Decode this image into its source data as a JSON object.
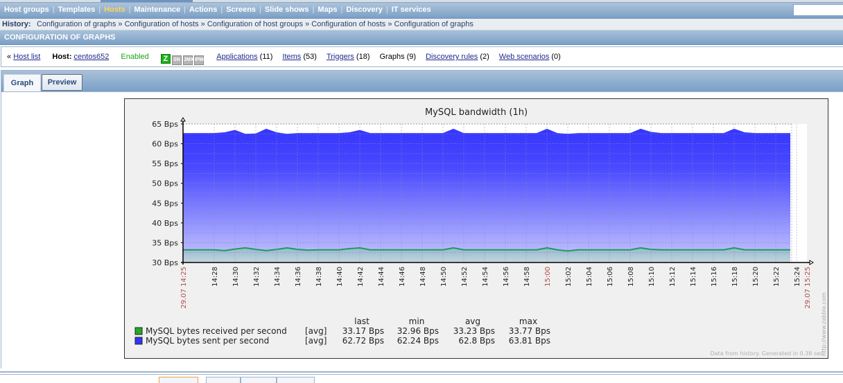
{
  "menu": {
    "items": [
      {
        "label": "Host groups",
        "active": false
      },
      {
        "label": "Templates",
        "active": false
      },
      {
        "label": "Hosts",
        "active": true
      },
      {
        "label": "Maintenance",
        "active": false
      },
      {
        "label": "Actions",
        "active": false
      },
      {
        "label": "Screens",
        "active": false
      },
      {
        "label": "Slide shows",
        "active": false
      },
      {
        "label": "Maps",
        "active": false
      },
      {
        "label": "Discovery",
        "active": false
      },
      {
        "label": "IT services",
        "active": false
      }
    ],
    "search_value": ""
  },
  "history": {
    "label": "History:",
    "crumbs": [
      "Configuration of graphs",
      "Configuration of hosts",
      "Configuration of host groups",
      "Configuration of hosts",
      "Configuration of graphs"
    ],
    "separator": "»"
  },
  "page_title": "CONFIGURATION OF GRAPHS",
  "hostbar": {
    "back_prefix": "«",
    "host_list": "Host list",
    "host_label": "Host:",
    "host_name": "centos652",
    "status": "Enabled",
    "availability": [
      {
        "name": "zabbix-agent",
        "glyph": "Z",
        "on": true
      },
      {
        "name": "snmp",
        "glyph": "SN",
        "on": false
      },
      {
        "name": "jmx",
        "glyph": "JMX",
        "on": false
      },
      {
        "name": "ipmi",
        "glyph": "IPMI",
        "on": false
      }
    ],
    "links": [
      {
        "label": "Applications",
        "count": "(11)",
        "link": true
      },
      {
        "label": "Items",
        "count": "(53)",
        "link": true
      },
      {
        "label": "Triggers",
        "count": "(18)",
        "link": true
      },
      {
        "label": "Graphs",
        "count": "(9)",
        "link": false
      },
      {
        "label": "Discovery rules",
        "count": "(2)",
        "link": true
      },
      {
        "label": "Web scenarios",
        "count": "(0)",
        "link": true
      }
    ]
  },
  "tabs": [
    {
      "label": "Graph",
      "active": true
    },
    {
      "label": "Preview",
      "active": false
    }
  ],
  "colors": {
    "received": "#1a9b5a",
    "received_legend": "#22aa22",
    "sent": "#3333ff",
    "axis_red": "#b24c4c"
  },
  "chart_data": {
    "type": "area",
    "title": "MySQL bandwidth (1h)",
    "xlabel": "",
    "ylabel": "",
    "y_unit": "Bps",
    "ylim": [
      30,
      65
    ],
    "yticks": [
      "30 Bps",
      "35 Bps",
      "40 Bps",
      "45 Bps",
      "50 Bps",
      "55 Bps",
      "60 Bps",
      "65 Bps"
    ],
    "ytick_values": [
      30,
      35,
      40,
      45,
      50,
      55,
      60,
      65
    ],
    "x_start_label": "29.07 14:25",
    "x_end_label": "29.07 15:25",
    "xticks": [
      "14:28",
      "14:30",
      "14:32",
      "14:34",
      "14:36",
      "14:38",
      "14:40",
      "14:42",
      "14:44",
      "14:46",
      "14:48",
      "14:50",
      "14:52",
      "14:54",
      "14:56",
      "14:58",
      "15:00",
      "15:02",
      "15:04",
      "15:06",
      "15:08",
      "15:10",
      "15:12",
      "15:14",
      "15:16",
      "15:18",
      "15:20",
      "15:22",
      "15:24"
    ],
    "xtick_minutes": [
      3,
      5,
      7,
      9,
      11,
      13,
      15,
      17,
      19,
      21,
      23,
      25,
      27,
      29,
      31,
      33,
      35,
      37,
      39,
      41,
      43,
      45,
      47,
      49,
      51,
      53,
      55,
      57,
      59
    ],
    "highlight_tick": "15:00",
    "x_range_minutes": [
      0,
      60
    ],
    "grid": true,
    "series": [
      {
        "name": "MySQL bytes received per second",
        "func": "[avg]",
        "last": "33.17 Bps",
        "min": "32.96 Bps",
        "avg": "33.23 Bps",
        "max": "33.77 Bps",
        "minutes": [
          0,
          3,
          4,
          5,
          6,
          7,
          8,
          9,
          10,
          11,
          12,
          13,
          14,
          15,
          16,
          17,
          18,
          25,
          26,
          27,
          34,
          35,
          36,
          37,
          38,
          43,
          44,
          45,
          46,
          47,
          52,
          53,
          54,
          55,
          58.4
        ],
        "values": [
          33.2,
          33.2,
          33.0,
          33.4,
          33.7,
          33.3,
          33.0,
          33.3,
          33.7,
          33.3,
          33.1,
          33.2,
          33.2,
          33.2,
          33.5,
          33.7,
          33.2,
          33.2,
          33.7,
          33.2,
          33.2,
          33.7,
          33.2,
          32.9,
          33.2,
          33.2,
          33.7,
          33.3,
          33.2,
          33.2,
          33.2,
          33.7,
          33.2,
          33.2,
          33.2
        ]
      },
      {
        "name": "MySQL bytes sent per second",
        "func": "[avg]",
        "last": "62.72 Bps",
        "min": "62.24 Bps",
        "avg": "62.8 Bps",
        "max": "63.81 Bps",
        "minutes": [
          0,
          3,
          4,
          5,
          6,
          7,
          8,
          9,
          10,
          11,
          12,
          13,
          14,
          15,
          16,
          17,
          18,
          25,
          26,
          27,
          34,
          35,
          36,
          37,
          38,
          43,
          44,
          45,
          46,
          47,
          52,
          53,
          54,
          55,
          58.4
        ],
        "values": [
          62.7,
          62.7,
          62.9,
          63.5,
          62.5,
          62.6,
          63.8,
          62.9,
          62.5,
          62.7,
          62.7,
          62.7,
          62.7,
          62.7,
          62.9,
          63.5,
          62.7,
          62.7,
          63.8,
          62.7,
          62.7,
          63.8,
          62.7,
          62.5,
          62.7,
          62.7,
          63.8,
          63.0,
          62.7,
          62.7,
          62.7,
          63.8,
          62.9,
          62.7,
          62.7
        ]
      }
    ],
    "legend_headers": [
      "last",
      "min",
      "avg",
      "max"
    ],
    "legend_position": "bottom-left",
    "watermark": "http://www.zabbix.com",
    "footer": "Data from history. Generated in 0.38 sec."
  }
}
